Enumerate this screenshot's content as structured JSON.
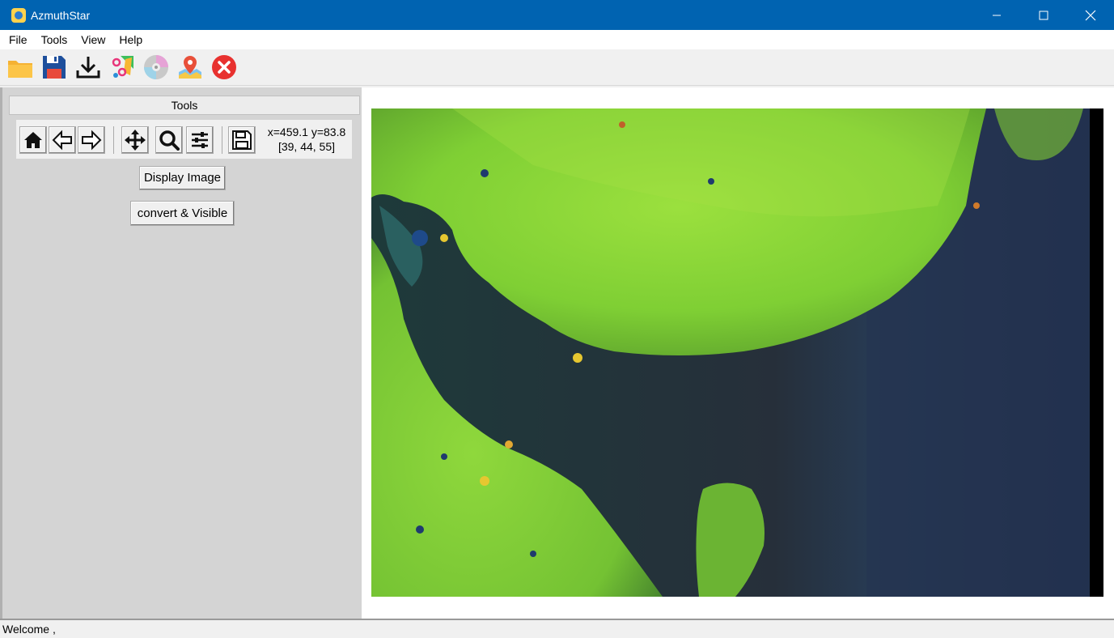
{
  "window": {
    "title": "AzmuthStar",
    "accent_color": "#0063b1"
  },
  "menu": {
    "items": [
      "File",
      "Tools",
      "View",
      "Help"
    ]
  },
  "toolbar": {
    "icons": [
      "open-folder-icon",
      "save-icon",
      "download-icon",
      "scatter-plot-icon",
      "disc-icon",
      "map-pin-icon",
      "close-circle-icon"
    ]
  },
  "tools_panel": {
    "header": "Tools",
    "coords_line1": "x=459.1 y=83.8",
    "coords_line2": "[39, 44, 55]",
    "display_image_label": "Display Image",
    "convert_label": "convert & Visible"
  },
  "status": {
    "text": "Welcome ,"
  }
}
